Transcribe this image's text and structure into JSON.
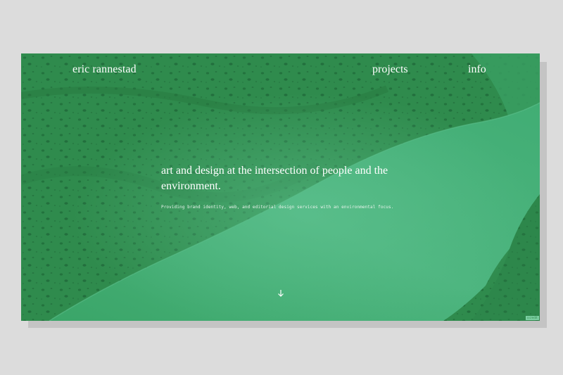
{
  "header": {
    "brand": "eric rannestad",
    "nav": {
      "projects": "projects",
      "info": "info"
    }
  },
  "hero": {
    "headline": "art and design at the intersection of people and the environment.",
    "subline": "Providing brand identity, web, and editorial design services with an environmental focus.",
    "scroll_icon": "arrow-down-icon"
  },
  "badge": {
    "label": "ℹ credit"
  },
  "colors": {
    "page_background": "#dcdcdc",
    "frame_green": "#2e8a4c",
    "water_green": "#45b27a",
    "text": "#ffffff"
  }
}
